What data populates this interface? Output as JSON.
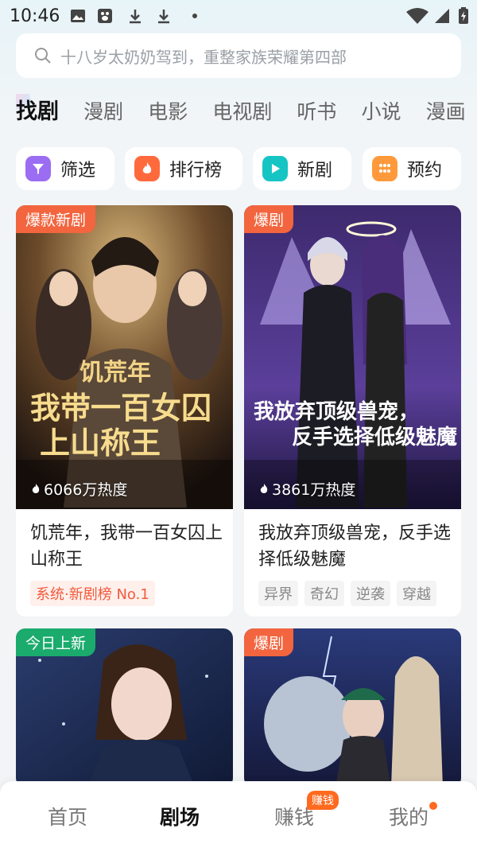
{
  "status_bar": {
    "time": "10:46"
  },
  "search": {
    "placeholder": "十八岁太奶奶驾到，重整家族荣耀第四部"
  },
  "tabs": [
    "找剧",
    "漫剧",
    "电影",
    "电视剧",
    "听书",
    "小说",
    "漫画"
  ],
  "quick_entries": [
    {
      "label": "筛选",
      "icon": "filter-icon",
      "color": "#9b6df2"
    },
    {
      "label": "排行榜",
      "icon": "fire-icon",
      "color": "#ff6a3d"
    },
    {
      "label": "新剧",
      "icon": "play-icon",
      "color": "#17c4c4"
    },
    {
      "label": "预约",
      "icon": "grid-dots-icon",
      "color": "#ff9a3c"
    }
  ],
  "cards": [
    {
      "tag": "爆款新剧",
      "tag_color": "#f2653f",
      "heat": "6066万热度",
      "title": "饥荒年，我带一百女囚上山称王",
      "rank": "系统·新剧榜 No.1",
      "poster_text_1": "饥荒年",
      "poster_text_2": "我带一百女囚",
      "poster_text_3": "上山称王"
    },
    {
      "tag": "爆剧",
      "tag_color": "#f2653f",
      "heat": "3861万热度",
      "title": "我放弃顶级兽宠，反手选择低级魅魔",
      "genres": [
        "异界",
        "奇幻",
        "逆袭",
        "穿越"
      ],
      "poster_text_1": "我放弃顶级兽宠，",
      "poster_text_2": "反手选择低级魅魔"
    },
    {
      "tag": "今日上新",
      "tag_color": "#1bab6d"
    },
    {
      "tag": "爆剧",
      "tag_color": "#f2653f"
    }
  ],
  "bottom_nav": {
    "items": [
      "首页",
      "剧场",
      "赚钱",
      "我的"
    ],
    "badge": "赚钱"
  }
}
